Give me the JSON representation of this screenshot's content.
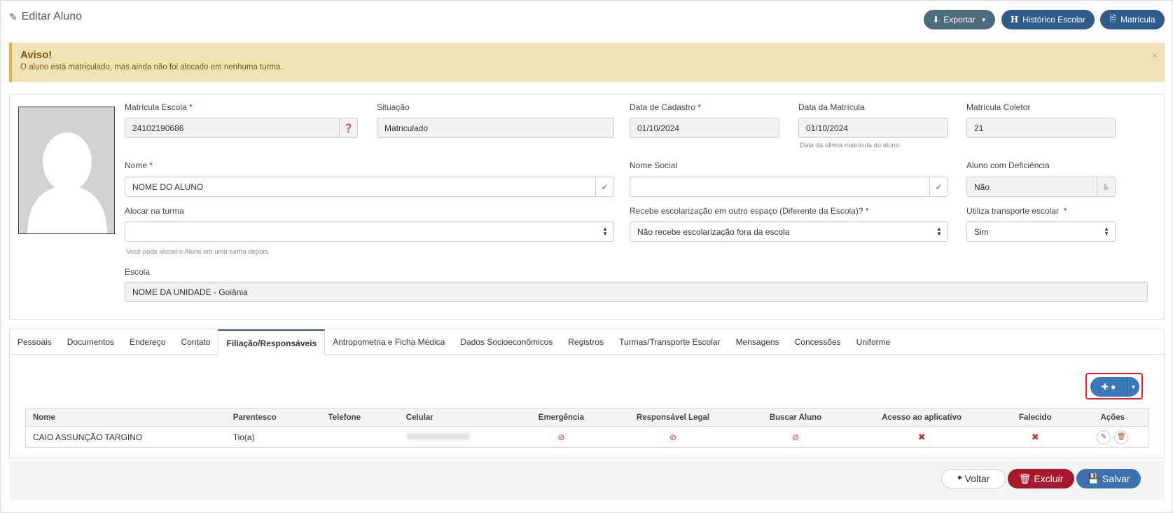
{
  "header": {
    "title": "Editar Aluno",
    "export_label": "Exportar",
    "historico_label": "Histórico Escolar",
    "matricula_label": "Matrícula"
  },
  "alert": {
    "title": "Aviso!",
    "text": "O aluno está matriculado, mas ainda não foi alocado em nenhuma turma.",
    "close": "×"
  },
  "form": {
    "matricula_escola": {
      "label": "Matrícula Escola",
      "value": "24102190686"
    },
    "situacao": {
      "label": "Situação",
      "value": "Matriculado"
    },
    "data_cadastro": {
      "label": "Data de Cadastro",
      "value": "01/10/2024"
    },
    "data_matricula": {
      "label": "Data da Matrícula",
      "value": "01/10/2024",
      "hint": "Data da última matrícula do aluno."
    },
    "matricula_coletor": {
      "label": "Matrícula Coletor",
      "value": "21"
    },
    "nome": {
      "label": "Nome",
      "value": "NOME DO ALUNO"
    },
    "nome_social": {
      "label": "Nome Social",
      "value": ""
    },
    "deficiencia": {
      "label": "Aluno com Deficiência",
      "value": "Não"
    },
    "alocar_turma": {
      "label": "Alocar na turma",
      "value": "",
      "hint": "Você pode alocar o Aluno em uma turma depois."
    },
    "escolarizacao": {
      "label": "Recebe escolarização em outro espaço (Diferente da Escola)?",
      "value": "Não recebe escolarização fora da escola"
    },
    "transporte": {
      "label": "Utiliza transporte escolar",
      "value": "Sim"
    },
    "escola": {
      "label": "Escola",
      "value": "NOME DA UNIDADE - Goiânia"
    }
  },
  "tabs": [
    {
      "label": "Pessoais"
    },
    {
      "label": "Documentos"
    },
    {
      "label": "Endereço"
    },
    {
      "label": "Contato"
    },
    {
      "label": "Filiação/Responsáveis",
      "active": true
    },
    {
      "label": "Antropometria e Ficha Médica"
    },
    {
      "label": "Dados Socioeconômicos"
    },
    {
      "label": "Registros"
    },
    {
      "label": "Turmas/Transporte Escolar"
    },
    {
      "label": "Mensagens"
    },
    {
      "label": "Concessões"
    },
    {
      "label": "Uniforme"
    }
  ],
  "table": {
    "headers": [
      "Nome",
      "Parentesco",
      "Telefone",
      "Celular",
      "Emergência",
      "Responsável Legal",
      "Buscar Aluno",
      "Acesso ao aplicativo",
      "Falecido",
      "Ações"
    ],
    "rows": [
      {
        "nome": "CAIO ASSUNÇÃO TARGINO",
        "parentesco": "Tio(a)",
        "telefone": "",
        "celular": ""
      }
    ]
  },
  "footer": {
    "voltar_label": "Voltar",
    "excluir_label": "Excluir",
    "salvar_label": "Salvar"
  },
  "colors": {
    "primary": "#2f5b8a",
    "danger": "#a8162a",
    "warning_bg": "#efe3b5",
    "highlight": "#e0202a"
  }
}
